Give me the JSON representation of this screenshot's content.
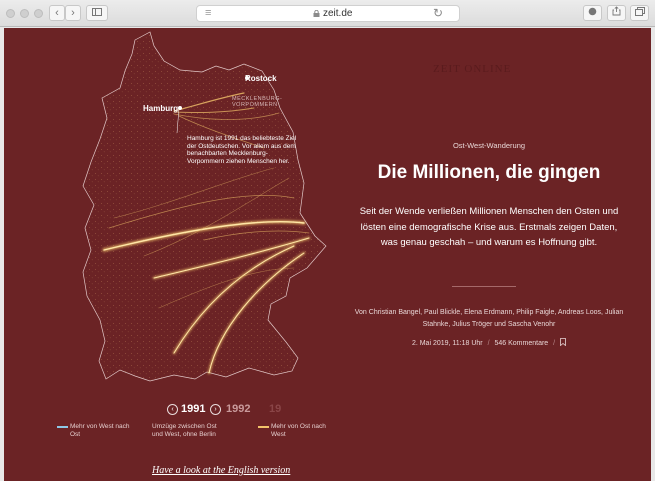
{
  "browser": {
    "url_host": "zeit.de"
  },
  "brand": "ZEIT ONLINE",
  "map": {
    "cities": {
      "rostock": "Rostock",
      "hamburg": "Hamburg"
    },
    "region_label": [
      "MECKLENBURG-",
      "VORPOMMERN"
    ],
    "annotation": "Hamburg ist 1991 das beliebteste Ziel der Ostdeutschen. Vor allem aus dem benachbarten Mecklenburg-Vorpommern ziehen Menschen her.",
    "years": {
      "current": "1991",
      "next": "1992",
      "faded": "19"
    },
    "legend": {
      "west_to_east": "Mehr von West nach Ost",
      "between": "Umzüge zwischen Ost und West, ohne Berlin",
      "east_to_west": "Mehr von Ost nach West"
    },
    "english_link": "Have a look at the English version"
  },
  "article": {
    "kicker": "Ost-West-Wanderung",
    "headline": "Die Millionen, die gingen",
    "subline": "Seit der Wende verließen Millionen Menschen den Osten und lösten eine demografische Krise aus. Erstmals zeigen Daten, was genau geschah – und warum es Hoffnung gibt.",
    "authors": "Von Christian Bangel, Paul Blickle, Elena Erdmann, Philip Faigle, Andreas Loos, Julian Stahnke, Julius Tröger und Sascha Venohr",
    "date": "2. Mai 2019, 11:18 Uhr",
    "comments": "546 Kommentare"
  },
  "colors": {
    "background": "#6b2325",
    "flow_east_to_west": "#f2c36b",
    "flow_west_to_east": "#8fc7e6"
  }
}
